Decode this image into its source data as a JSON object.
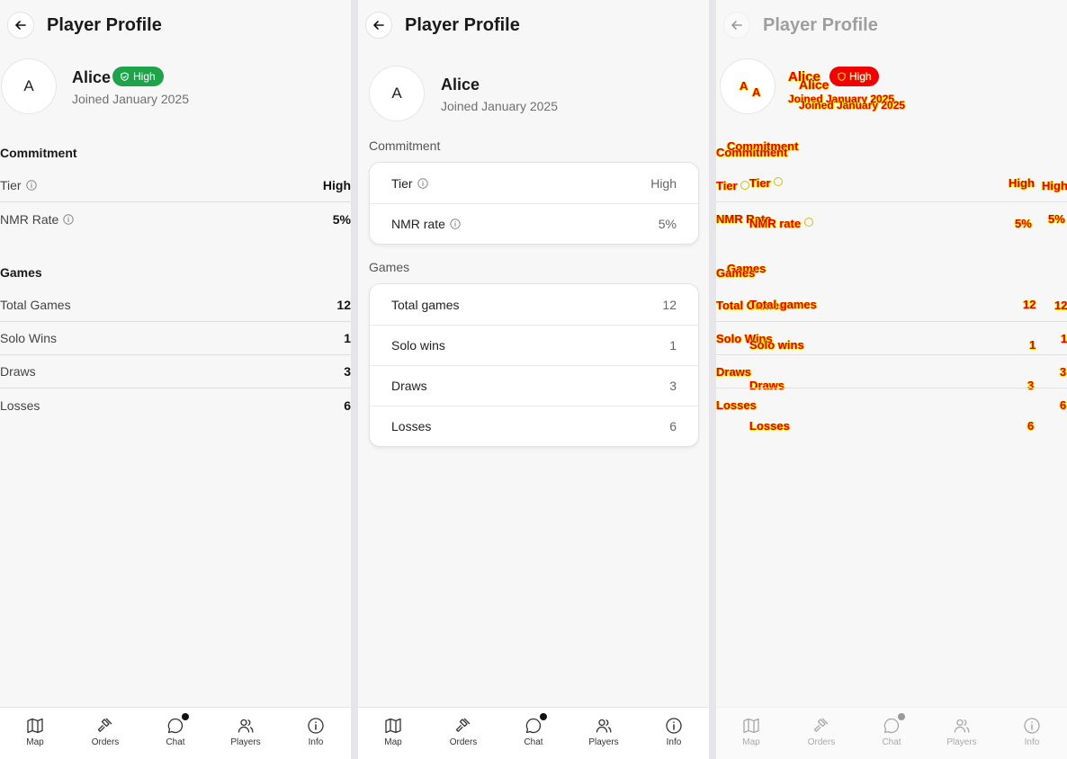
{
  "page": {
    "title": "Player Profile"
  },
  "player": {
    "initial": "A",
    "name": "Alice",
    "joined": "Joined January 2025",
    "badge": "High"
  },
  "panel_a": {
    "commitment_title": "Commitment",
    "commitment_rows": [
      {
        "label": "Tier",
        "value": "High",
        "info": true
      },
      {
        "label": "NMR Rate",
        "value": "5%",
        "info": true
      }
    ],
    "games_title": "Games",
    "games_rows": [
      {
        "label": "Total Games",
        "value": "12"
      },
      {
        "label": "Solo Wins",
        "value": "1"
      },
      {
        "label": "Draws",
        "value": "3"
      },
      {
        "label": "Losses",
        "value": "6"
      }
    ]
  },
  "panel_b": {
    "commitment_title": "Commitment",
    "commitment_rows": [
      {
        "label": "Tier",
        "value": "High"
      },
      {
        "label": "NMR rate",
        "value": "5%"
      }
    ],
    "games_title": "Games",
    "games_rows": [
      {
        "label": "Total games",
        "value": "12"
      },
      {
        "label": "Solo wins",
        "value": "1"
      },
      {
        "label": "Draws",
        "value": "3"
      },
      {
        "label": "Losses",
        "value": "6"
      }
    ]
  },
  "nav": [
    {
      "label": "Map",
      "icon": "map-icon"
    },
    {
      "label": "Orders",
      "icon": "gavel-icon"
    },
    {
      "label": "Chat",
      "icon": "chat-icon",
      "notification": true
    },
    {
      "label": "Players",
      "icon": "players-icon"
    },
    {
      "label": "Info",
      "icon": "info-icon"
    }
  ],
  "colors": {
    "badge": "#1ea34a",
    "overlay_text": "#e00000",
    "overlay_outline": "#ffe100"
  }
}
